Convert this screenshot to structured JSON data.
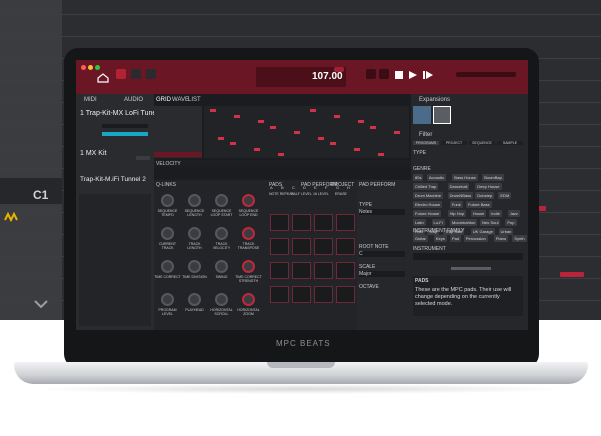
{
  "background_daw": {
    "track_label": "C1"
  },
  "header": {
    "bpm": "107.00"
  },
  "track_panel": {
    "tab_midi": "MIDI",
    "tab_audio": "AUDIO",
    "track_1_name": "1 Trap-Kit-MX LoFi Tunel",
    "kit_name": "1 MX Kit",
    "track_2_name": "Trap-Kit-M.iFi Tunnel 2"
  },
  "arrange": {
    "tabs": [
      "GRID",
      "WAVE",
      "LIST"
    ],
    "velocity_label": "VELOCITY"
  },
  "qlink": {
    "tabs": [
      "Q-LINKS",
      "PADS",
      "PAD PERFORM",
      "PROJECT"
    ],
    "knob_labels": [
      "SEQUENCE TEMPO",
      "SEQUENCE LENGTH",
      "SEQUENCE LOOP START",
      "SEQUENCE LOOP END",
      "CURRENT TRACK",
      "TRACK LENGTH",
      "TRACK VELOCITY",
      "TRACK TRANSPOSE",
      "TIME CORRECT",
      "TIME DIVISION",
      "SWING",
      "TIME CORRECT STRENGTH",
      "PROGRAM LEVEL",
      "PLAYHEAD",
      "HORIZONTAL SCROLL",
      "HORIZONTAL ZOOM"
    ]
  },
  "pads": {
    "controls": [
      "NOTE REPEAT",
      "HALF LEVEL",
      "16 LEVEL",
      "ERASE"
    ],
    "banks": [
      "A",
      "B",
      "C",
      "D",
      "E",
      "F",
      "G",
      "H"
    ]
  },
  "pad_perform": {
    "title": "PAD PERFORM",
    "type_label": "TYPE",
    "type_value": "Notes",
    "root_note_label": "ROOT NOTE",
    "root_note_value": "C",
    "scale_label": "SCALE",
    "scale_value": "Major",
    "octave_label": "OCTAVE"
  },
  "browser": {
    "expansions_label": "Expansions",
    "filter_label": "Filter",
    "filter_tabs": [
      "PROGRAMS",
      "PROJECT",
      "SEQUENCE",
      "SAMPLE"
    ],
    "type_label": "TYPE",
    "genre_label": "GENRE",
    "genres": [
      "80s",
      "Acoustic",
      "Bass House",
      "BoomBap",
      "Chilled Trap",
      "Dancehall",
      "Deep House",
      "Drum Machine",
      "DrumNBass",
      "Dubstep",
      "EDM",
      "Electro House",
      "Funk",
      "Future Bass",
      "Future House",
      "Hip Hop",
      "House",
      "Indie",
      "Jazz",
      "Latin",
      "Lo-Fi",
      "Moombahton",
      "Neo Soul",
      "Pop",
      "RnB",
      "Trap",
      "Trap Soul",
      "UK Garage",
      "Urban"
    ],
    "instrument_family_label": "INSTRUMENT FAMILY",
    "families": [
      "Guitar",
      "Keys",
      "Pad",
      "Percussion",
      "Piano",
      "Synth"
    ],
    "instrument_label": "INSTRUMENT",
    "pads_title": "PADS",
    "pads_note": "These are the MPC pads. Their use will change depending on the currently selected mode."
  },
  "footer": {
    "logo": "MPC BEATS"
  },
  "colors": {
    "accent": "#c0283c",
    "header": "#6a1624",
    "panel": "#232428"
  }
}
